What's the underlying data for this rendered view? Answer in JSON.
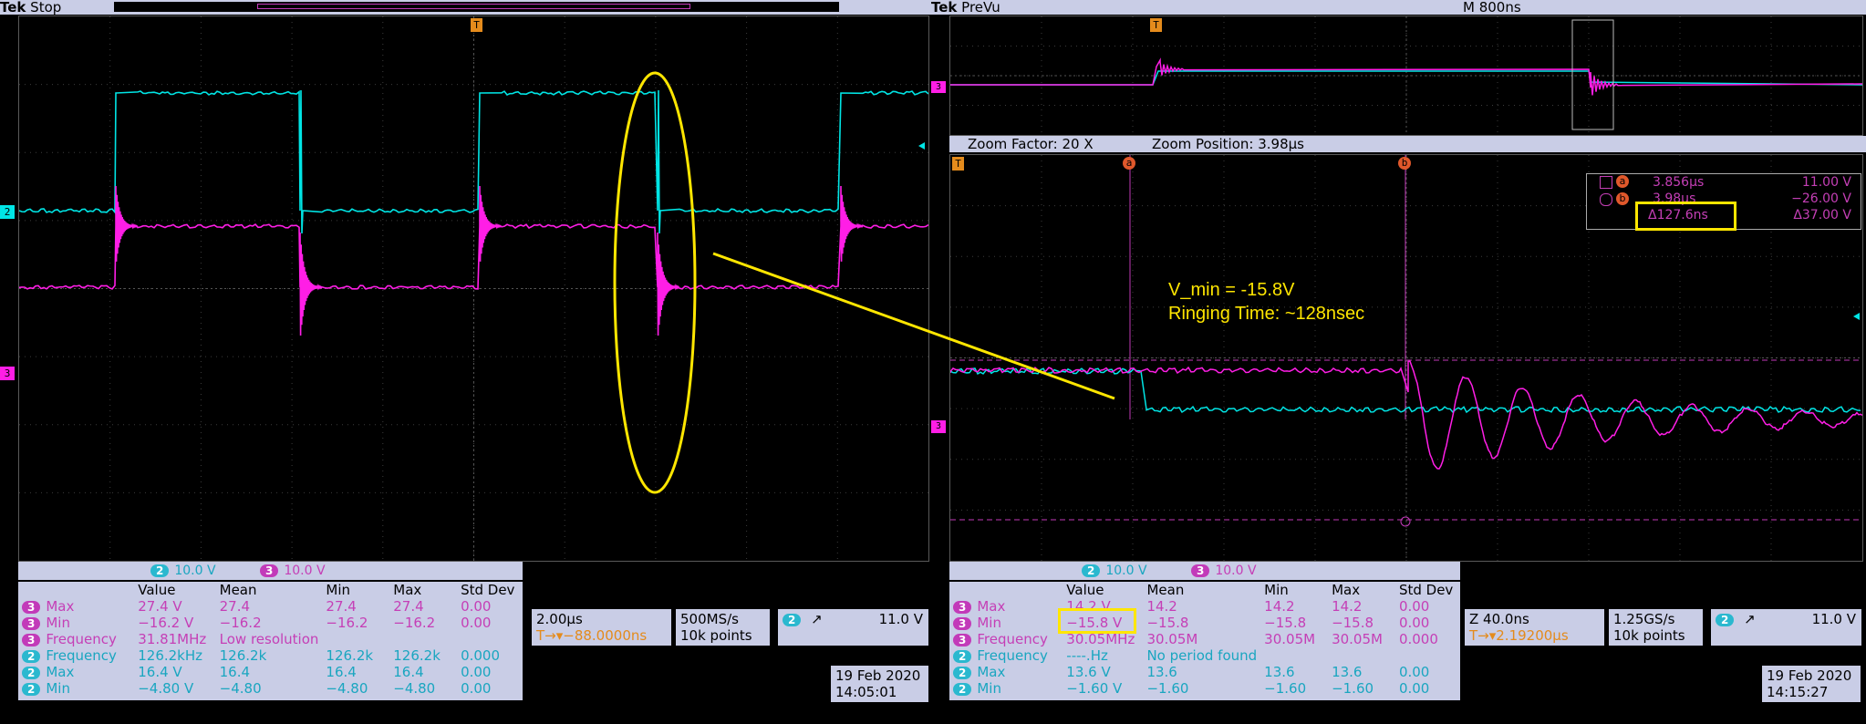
{
  "left": {
    "header": {
      "brand": "Tek",
      "state": "Stop"
    },
    "trigger_marker": "T",
    "channel_markers": {
      "ch2": "2",
      "ch3": "3"
    },
    "channel_bar": {
      "ch2_badge": "2",
      "ch2_scale": "10.0 V",
      "ch3_badge": "3",
      "ch3_scale": "10.0 V"
    },
    "measurements": {
      "columns": [
        "Value",
        "Mean",
        "Min",
        "Max",
        "Std Dev"
      ],
      "rows": [
        {
          "ch": "3",
          "name": "Max",
          "value": "27.4 V",
          "mean": "27.4",
          "min": "27.4",
          "max": "27.4",
          "std": "0.00"
        },
        {
          "ch": "3",
          "name": "Min",
          "value": "−16.2 V",
          "mean": "−16.2",
          "min": "−16.2",
          "max": "−16.2",
          "std": "0.00"
        },
        {
          "ch": "3",
          "name": "Frequency",
          "value": "31.81MHz",
          "mean": "Low resolution",
          "min": "",
          "max": "",
          "std": ""
        },
        {
          "ch": "2",
          "name": "Frequency",
          "value": "126.2kHz",
          "mean": "126.2k",
          "min": "126.2k",
          "max": "126.2k",
          "std": "0.000"
        },
        {
          "ch": "2",
          "name": "Max",
          "value": "16.4 V",
          "mean": "16.4",
          "min": "16.4",
          "max": "16.4",
          "std": "0.00"
        },
        {
          "ch": "2",
          "name": "Min",
          "value": "−4.80 V",
          "mean": "−4.80",
          "min": "−4.80",
          "max": "−4.80",
          "std": "0.00"
        }
      ]
    },
    "horizontal": {
      "scale": "2.00µs",
      "position": "T→▾−88.0000ns"
    },
    "acquisition": {
      "rate": "500MS/s",
      "points": "10k points"
    },
    "trigger": {
      "badge": "2",
      "slope": "↗",
      "level": "11.0 V"
    },
    "date": "19 Feb  2020",
    "time": "14:05:01"
  },
  "right": {
    "header": {
      "brand": "Tek",
      "state": "PreVu",
      "record": "M 800ns"
    },
    "zoom": {
      "factor": "Zoom Factor: 20 X",
      "position": "Zoom Position: 3.98µs"
    },
    "cursor_markers": {
      "a": "a",
      "b": "b",
      "t": "T"
    },
    "cursor_readout": {
      "a_time": "3.856µs",
      "a_volt": "11.00 V",
      "b_time": "3.98µs",
      "b_volt": "−26.00 V",
      "delta_time": "Δ127.6ns",
      "delta_volt": "Δ37.00 V"
    },
    "annotation": {
      "line1": "V_min = -15.8V",
      "line2": "Ringing Time: ~128nsec"
    },
    "channel_bar": {
      "ch2_badge": "2",
      "ch2_scale": "10.0 V",
      "ch3_badge": "3",
      "ch3_scale": "10.0 V"
    },
    "measurements": {
      "columns": [
        "Value",
        "Mean",
        "Min",
        "Max",
        "Std Dev"
      ],
      "rows": [
        {
          "ch": "3",
          "name": "Max",
          "value": "14.2 V",
          "mean": "14.2",
          "min": "14.2",
          "max": "14.2",
          "std": "0.00"
        },
        {
          "ch": "3",
          "name": "Min",
          "value": "−15.8 V",
          "mean": "−15.8",
          "min": "−15.8",
          "max": "−15.8",
          "std": "0.00"
        },
        {
          "ch": "3",
          "name": "Frequency",
          "value": "30.05MHz",
          "mean": "30.05M",
          "min": "30.05M",
          "max": "30.05M",
          "std": "0.000"
        },
        {
          "ch": "2",
          "name": "Frequency",
          "value": "----.Hz",
          "mean": "No period found",
          "min": "",
          "max": "",
          "std": ""
        },
        {
          "ch": "2",
          "name": "Max",
          "value": "13.6 V",
          "mean": "13.6",
          "min": "13.6",
          "max": "13.6",
          "std": "0.00"
        },
        {
          "ch": "2",
          "name": "Min",
          "value": "−1.60 V",
          "mean": "−1.60",
          "min": "−1.60",
          "max": "−1.60",
          "std": "0.00"
        }
      ]
    },
    "horizontal": {
      "scale": "Z 40.0ns",
      "position": "T→▾2.19200µs"
    },
    "acquisition": {
      "rate": "1.25GS/s",
      "points": "10k points"
    },
    "trigger": {
      "badge": "2",
      "slope": "↗",
      "level": "11.0 V"
    },
    "date": "19 Feb  2020",
    "time": "14:15:27"
  },
  "colors": {
    "ch2": "#00e5e5",
    "ch3": "#ff1ee6",
    "highlight": "#ffe600",
    "marker": "#e48b1c"
  }
}
